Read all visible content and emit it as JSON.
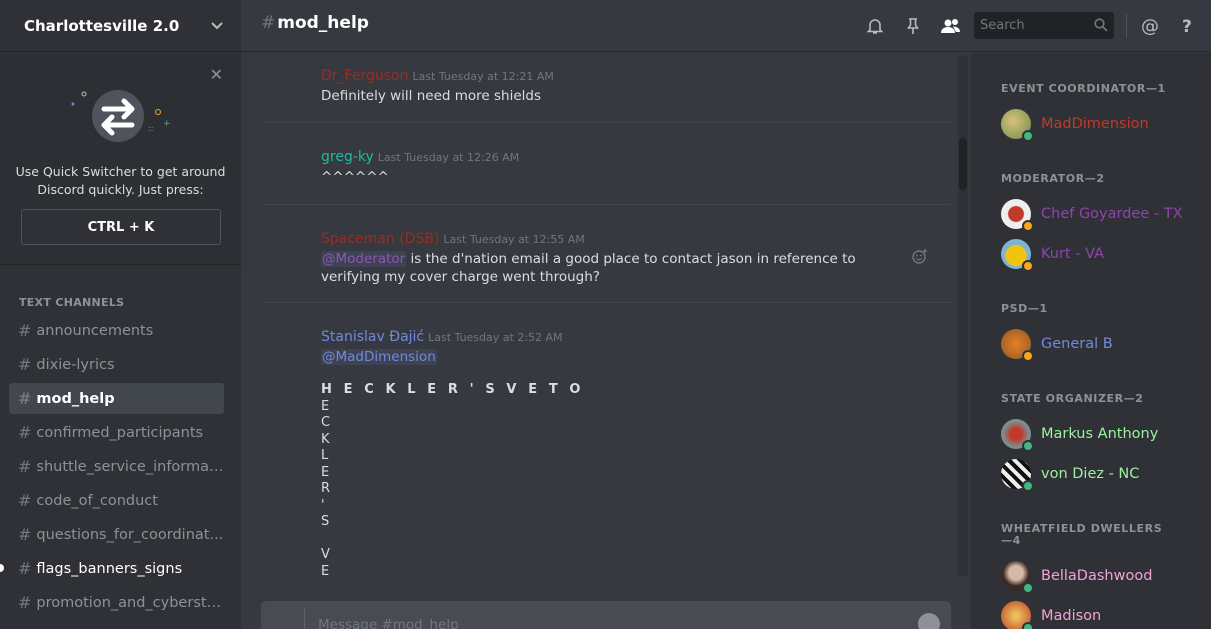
{
  "server": {
    "name": "Charlottesville 2.0"
  },
  "quick_switcher": {
    "text": "Use Quick Switcher to get around Discord quickly. Just press:",
    "shortcut": "CTRL + K"
  },
  "channels": {
    "header": "TEXT CHANNELS",
    "items": [
      {
        "label": "announcements",
        "state": "normal"
      },
      {
        "label": "dixie-lyrics",
        "state": "normal"
      },
      {
        "label": "mod_help",
        "state": "active"
      },
      {
        "label": "confirmed_participants",
        "state": "normal"
      },
      {
        "label": "shuttle_service_informat...",
        "state": "normal"
      },
      {
        "label": "code_of_conduct",
        "state": "normal"
      },
      {
        "label": "questions_for_coordinat...",
        "state": "normal"
      },
      {
        "label": "flags_banners_signs",
        "state": "unread"
      },
      {
        "label": "promotion_and_cyberstr...",
        "state": "normal"
      }
    ]
  },
  "header": {
    "channel": "mod_help",
    "hash": "#",
    "search_placeholder": "Search"
  },
  "messages": [
    {
      "author": "Dr_Ferguson",
      "color": "#992d22",
      "time": "Last Tuesday at 12:21 AM",
      "text": "Definitely will need more shields"
    },
    {
      "author": "greg-ky",
      "color": "#1abc9c",
      "time": "Last Tuesday at 12:26 AM",
      "text": "^^^^^^"
    },
    {
      "author": "Spaceman (DSB)",
      "color": "#992d22",
      "time": "Last Tuesday at 12:55 AM",
      "mention": "@Moderator",
      "text": " is the d'nation email a good place to contact jason in reference to verifying my cover charge went through?"
    },
    {
      "author": "Stanislav Đajić",
      "color": "#7289da",
      "time": "Last Tuesday at 2:52 AM",
      "mention": "@MadDimension",
      "heading": "H E C K L E R ' S   V E T O",
      "vertical": [
        "E",
        "C",
        "K",
        "L",
        "E",
        "R",
        "'",
        "S",
        "",
        "V",
        "E"
      ]
    }
  ],
  "input": {
    "placeholder": "Message #mod_help"
  },
  "members": {
    "groups": [
      {
        "name": "EVENT COORDINATOR—1",
        "members": [
          {
            "name": "MadDimension",
            "color": "#c0392b",
            "status": "online"
          }
        ]
      },
      {
        "name": "MODERATOR—2",
        "members": [
          {
            "name": "Chef Goyardee - TX",
            "color": "#8e44ad",
            "status": "idle"
          },
          {
            "name": "Kurt - VA",
            "color": "#8e44ad",
            "status": "idle"
          }
        ]
      },
      {
        "name": "PSD—1",
        "members": [
          {
            "name": "General B",
            "color": "#7289da",
            "status": "idle"
          }
        ]
      },
      {
        "name": "STATE ORGANIZER—2",
        "members": [
          {
            "name": "Markus Anthony",
            "color": "#9cf29f",
            "status": "online"
          },
          {
            "name": "von Diez - NC",
            "color": "#9cf29f",
            "status": "online"
          }
        ]
      },
      {
        "name": "WHEATFIELD DWELLERS—4",
        "members": [
          {
            "name": "BellaDashwood",
            "color": "#f2a3d6",
            "status": "online"
          },
          {
            "name": "Madison",
            "color": "#f2a3d6",
            "status": "online"
          }
        ]
      }
    ]
  },
  "colors": {
    "online": "#43b581",
    "idle": "#faa61a",
    "accent": "#7289da"
  },
  "icons": [
    "chevron-down-icon",
    "close-icon",
    "quick-switcher-arrows-icon",
    "bell-icon",
    "pin-icon",
    "members-icon",
    "search-icon",
    "at-icon",
    "help-icon",
    "add-reaction-icon",
    "emoji-icon"
  ]
}
